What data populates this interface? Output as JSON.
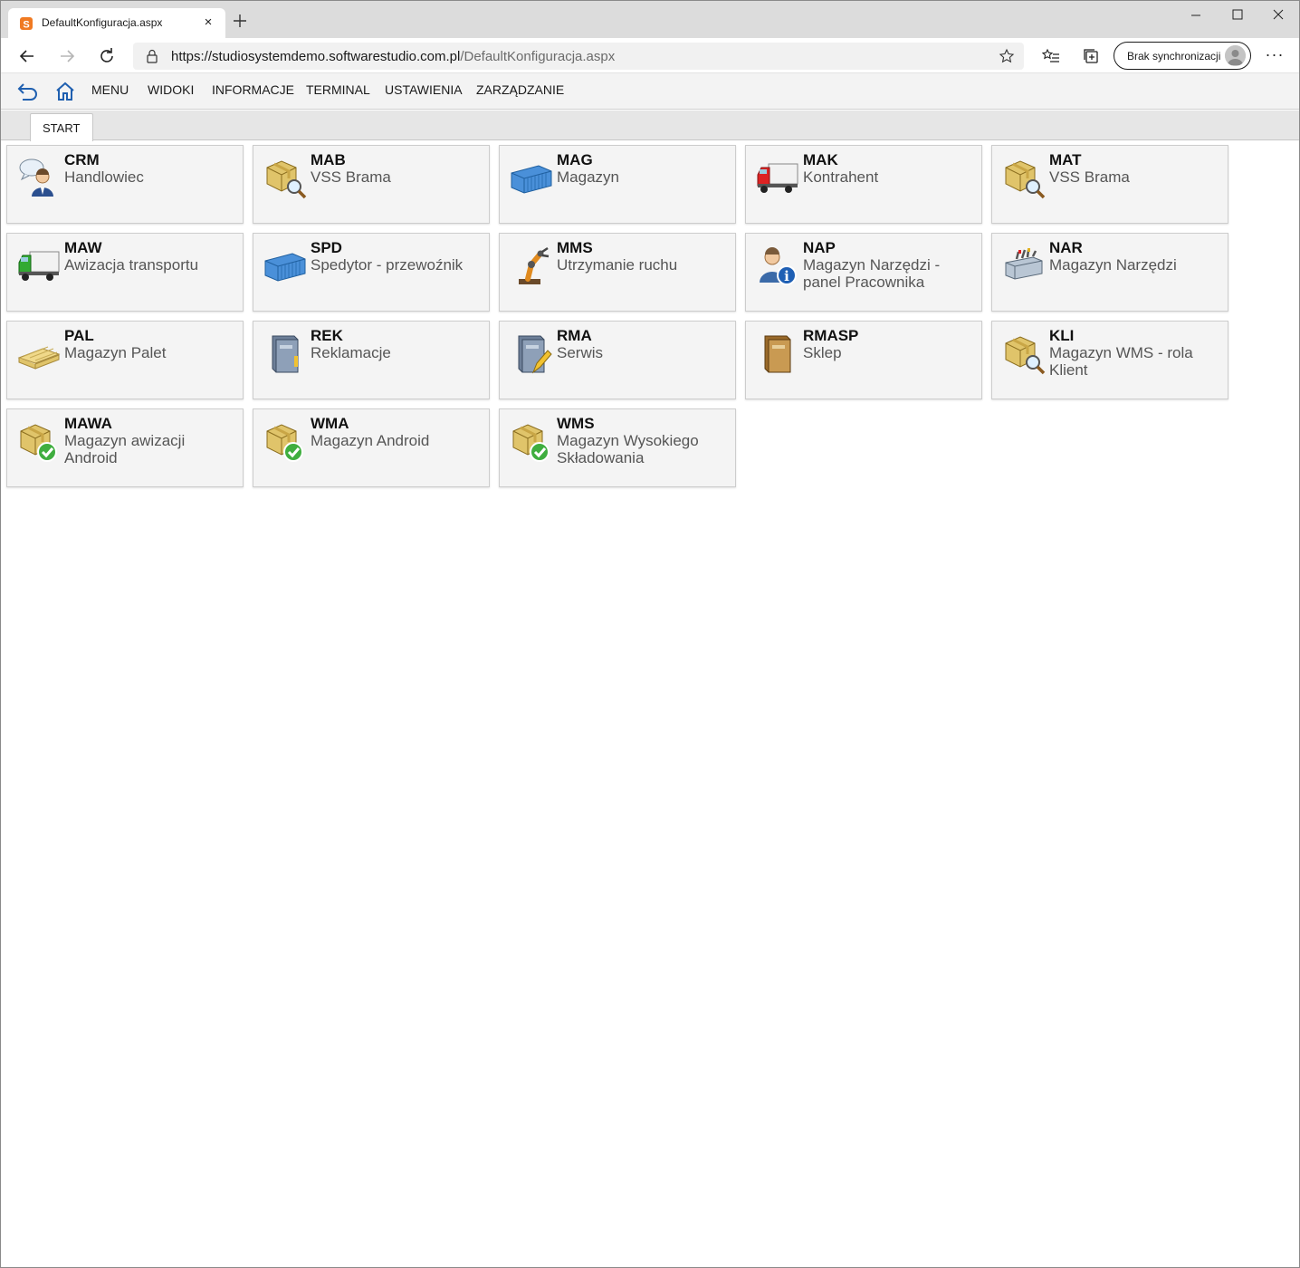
{
  "browser": {
    "tab_title": "DefaultKonfiguracja.aspx",
    "tab_close": "×",
    "url_host": "https://studiosystemdemo.softwarestudio.com.pl",
    "url_path": "/DefaultKonfiguracja.aspx",
    "sync_label": "Brak synchronizacji",
    "more": "···"
  },
  "menu": {
    "items": [
      "MENU",
      "WIDOKI",
      "INFORMACJE",
      "TERMINAL",
      "USTAWIENIA",
      "ZARZĄDZANIE"
    ]
  },
  "tabs": {
    "start": "START"
  },
  "tiles": [
    {
      "code": "CRM",
      "desc": "Handlowiec",
      "icon": "salesman-icon"
    },
    {
      "code": "MAB",
      "desc": "VSS Brama",
      "icon": "box-search-icon"
    },
    {
      "code": "MAG",
      "desc": "Magazyn",
      "icon": "container-icon"
    },
    {
      "code": "MAK",
      "desc": "Kontrahent",
      "icon": "red-truck-icon"
    },
    {
      "code": "MAT",
      "desc": "VSS Brama",
      "icon": "box-search-icon"
    },
    {
      "code": "MAW",
      "desc": "Awizacja transportu",
      "icon": "green-truck-icon"
    },
    {
      "code": "SPD",
      "desc": "Spedytor - przewoźnik",
      "icon": "container-icon"
    },
    {
      "code": "MMS",
      "desc": "Utrzymanie ruchu",
      "icon": "robot-arm-icon"
    },
    {
      "code": "NAP",
      "desc": "Magazyn Narzędzi - panel Pracownika",
      "icon": "user-info-icon"
    },
    {
      "code": "NAR",
      "desc": "Magazyn Narzędzi",
      "icon": "toolbox-icon"
    },
    {
      "code": "PAL",
      "desc": "Magazyn Palet",
      "icon": "pallet-icon"
    },
    {
      "code": "REK",
      "desc": "Reklamacje",
      "icon": "book-icon"
    },
    {
      "code": "RMA",
      "desc": "Serwis",
      "icon": "book-edit-icon"
    },
    {
      "code": "RMASP",
      "desc": "Sklep",
      "icon": "brown-book-icon"
    },
    {
      "code": "KLI",
      "desc": "Magazyn WMS - rola Klient",
      "icon": "box-search-icon"
    },
    {
      "code": "MAWA",
      "desc": "Magazyn awizacji Android",
      "icon": "box-check-icon"
    },
    {
      "code": "WMA",
      "desc": "Magazyn Android",
      "icon": "box-check-icon"
    },
    {
      "code": "WMS",
      "desc": "Magazyn Wysokiego Składowania",
      "icon": "box-check-icon"
    }
  ]
}
